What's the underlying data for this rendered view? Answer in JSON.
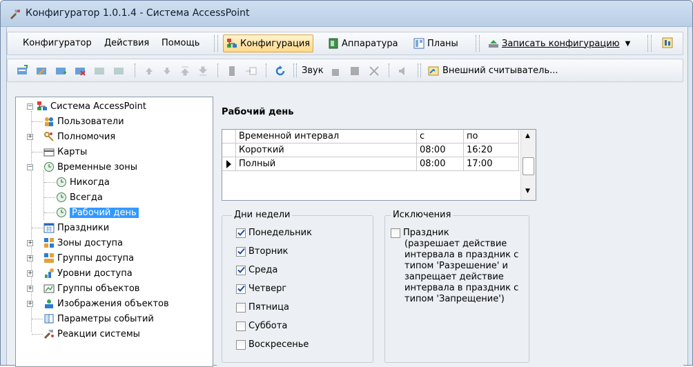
{
  "window": {
    "title": "Конфигуратор 1.0.1.4 - Система AccessPoint"
  },
  "menu": {
    "items": [
      "Конфигуратор",
      "Действия",
      "Помощь"
    ]
  },
  "main_toolbar": {
    "configuration": "Конфигурация",
    "hardware": "Аппаратура",
    "plans": "Планы",
    "write_config": "Записать конфигурацию"
  },
  "toolbar2": {
    "sound": "Звук",
    "external_reader": "Внешний считыватель..."
  },
  "tree": {
    "root": "Система AccessPoint",
    "items": [
      "Пользователи",
      "Полномочия",
      "Карты",
      "Временные зоны",
      "Никогда",
      "Всегда",
      "Рабочий день",
      "Праздники",
      "Зоны доступа",
      "Группы доступа",
      "Уровни доступа",
      "Группы объектов",
      "Изображения объектов",
      "Параметры событий",
      "Реакции системы"
    ]
  },
  "detail": {
    "title": "Рабочий день",
    "grid": {
      "headers": [
        "Временной интервал",
        "с",
        "по"
      ],
      "rows": [
        [
          "Короткий",
          "08:00",
          "16:20"
        ],
        [
          "Полный",
          "08:00",
          "17:00"
        ]
      ]
    },
    "days_group": "Дни недели",
    "days": [
      {
        "label": "Понедельник",
        "checked": true
      },
      {
        "label": "Вторник",
        "checked": true
      },
      {
        "label": "Среда",
        "checked": true
      },
      {
        "label": "Четверг",
        "checked": true
      },
      {
        "label": "Пятница",
        "checked": false
      },
      {
        "label": "Суббота",
        "checked": false
      },
      {
        "label": "Воскресенье",
        "checked": false
      }
    ],
    "exceptions_group": "Исключения",
    "holiday_label": "Праздник",
    "holiday_desc": "(разрешает действие интервала в праздник с типом 'Разрешение' и запрещает действие интервала в праздник с типом 'Запрещение')"
  }
}
